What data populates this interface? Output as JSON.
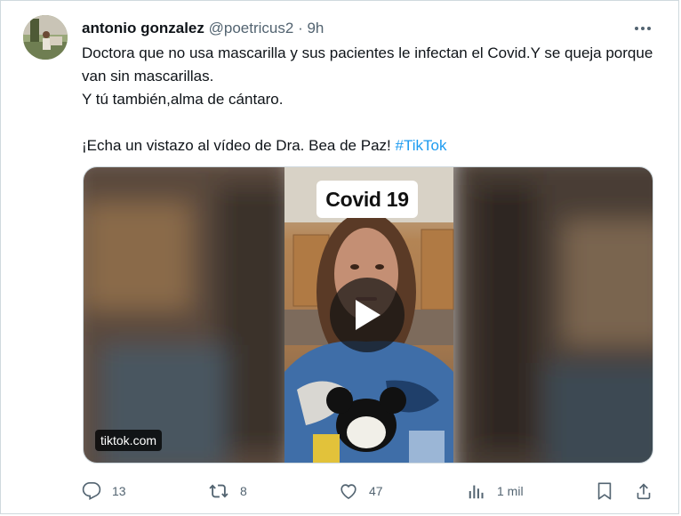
{
  "tweet": {
    "author_name": "antonio gonzalez",
    "author_handle": "@poetricus2",
    "separator": "·",
    "time": "9h",
    "text_line1": "Doctora que no usa mascarilla y sus pacientes le infectan el Covid.Y se queja porque van sin mascarillas.",
    "text_line2": "Y tú también,alma de cántaro.",
    "text_line3": "¡Echa un vistazo al vídeo de Dra. Bea de Paz!",
    "hashtag": "#TikTok"
  },
  "media": {
    "overlay_caption": "Covid 19",
    "source_label": "tiktok.com",
    "play_icon": "play-icon"
  },
  "actions": {
    "reply_count": "13",
    "retweet_count": "8",
    "like_count": "47",
    "views_count": "1 mil"
  },
  "icons": {
    "more": "more-icon",
    "reply": "reply-icon",
    "retweet": "retweet-icon",
    "like": "heart-icon",
    "views": "views-icon",
    "bookmark": "bookmark-icon",
    "share": "share-icon"
  },
  "colors": {
    "text": "#0f1419",
    "secondary": "#536471",
    "link": "#1d9bf0",
    "border": "#cfd9de"
  }
}
